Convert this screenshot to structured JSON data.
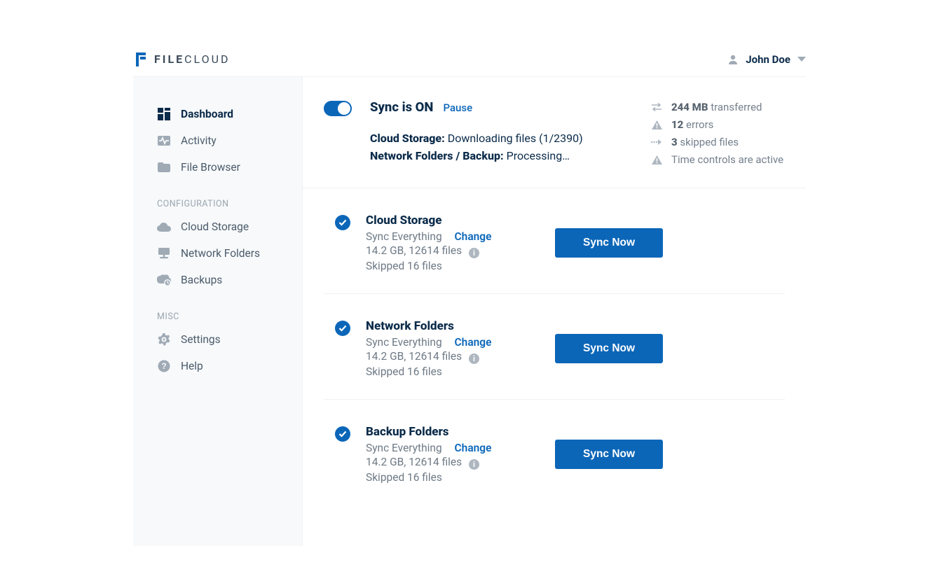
{
  "brand": {
    "text": "FILECLOUD",
    "bold_prefix": "FILE",
    "rest": "CLOUD"
  },
  "user": {
    "name": "John Doe"
  },
  "sidebar": {
    "items_main": [
      {
        "label": "Dashboard",
        "icon": "dashboard-icon",
        "active": true
      },
      {
        "label": "Activity",
        "icon": "activity-icon",
        "active": false
      },
      {
        "label": "File Browser",
        "icon": "folder-icon",
        "active": false
      }
    ],
    "section_config_label": "CONFIGURATION",
    "items_config": [
      {
        "label": "Cloud Storage",
        "icon": "cloud-icon"
      },
      {
        "label": "Network Folders",
        "icon": "network-icon"
      },
      {
        "label": "Backups",
        "icon": "backup-icon"
      }
    ],
    "section_misc_label": "MISC",
    "items_misc": [
      {
        "label": "Settings",
        "icon": "gear-icon"
      },
      {
        "label": "Help",
        "icon": "help-icon"
      }
    ]
  },
  "status": {
    "heading": "Sync is ON",
    "pause_label": "Pause",
    "line_cloud_label": "Cloud Storage:",
    "line_cloud_value": "Downloading files (1/2390)",
    "line_net_label": "Network Folders / Backup:",
    "line_net_value": "Processing…",
    "stats": {
      "transferred_bold": "244 MB",
      "transferred_rest": "transferred",
      "errors_bold": "12",
      "errors_rest": "errors",
      "skipped_bold": "3",
      "skipped_rest": "skipped files",
      "timectl": "Time controls are active"
    }
  },
  "cards": [
    {
      "title": "Cloud Storage",
      "mode": "Sync Everything",
      "change_label": "Change",
      "stats": "14.2 GB, 12614 files",
      "skipped": "Skipped 16 files",
      "button": "Sync Now"
    },
    {
      "title": "Network Folders",
      "mode": "Sync Everything",
      "change_label": "Change",
      "stats": "14.2 GB, 12614 files",
      "skipped": "Skipped 16 files",
      "button": "Sync Now"
    },
    {
      "title": "Backup Folders",
      "mode": "Sync Everything",
      "change_label": "Change",
      "stats": "14.2 GB, 12614 files",
      "skipped": "Skipped 16 files",
      "button": "Sync Now"
    }
  ]
}
